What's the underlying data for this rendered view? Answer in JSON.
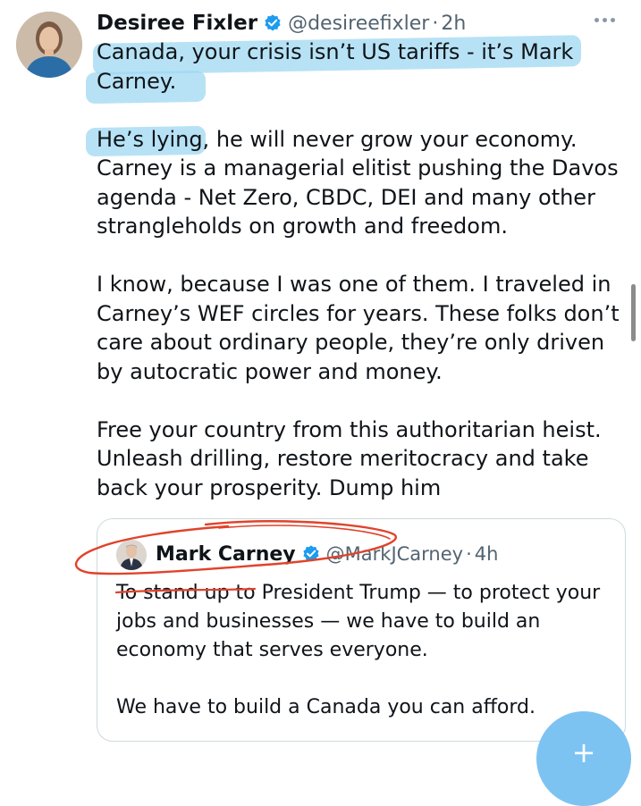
{
  "post": {
    "author_name": "Desiree Fixler",
    "author_handle": "@desireefixler",
    "separator": "·",
    "time": "2h",
    "paragraphs": [
      "Canada, your crisis isn’t US tariffs - it’s Mark Carney.",
      "He’s lying, he will never grow your economy. Carney is a managerial elitist pushing the Davos agenda - Net Zero, CBDC, DEI and many other strangleholds on growth and freedom.",
      "I know, because I was one of them.  I traveled in Carney’s WEF circles for years.  These folks don’t care about ordinary people, they’re only driven by autocratic power and money.",
      "Free your country from this authoritarian heist. Unleash drilling, restore meritocracy and take back your prosperity.  Dump him"
    ]
  },
  "quoted": {
    "author_name": "Mark Carney",
    "author_handle": "@MarkJCarney",
    "separator": "·",
    "time": "4h",
    "paragraphs": [
      "To stand up to President Trump — to protect your jobs and businesses — we have to build an economy that serves everyone.",
      "We have to build a Canada you can afford."
    ]
  },
  "fab": {
    "symbol": "+"
  },
  "colors": {
    "highlight": "#9fd8f2",
    "annotation": "#e0432b",
    "verified": "#1d9bf0",
    "handle_gray": "#536471",
    "fab": "#7cc3f2"
  },
  "icons": [
    "verified-badge-icon",
    "more-options-icon",
    "compose-icon"
  ]
}
